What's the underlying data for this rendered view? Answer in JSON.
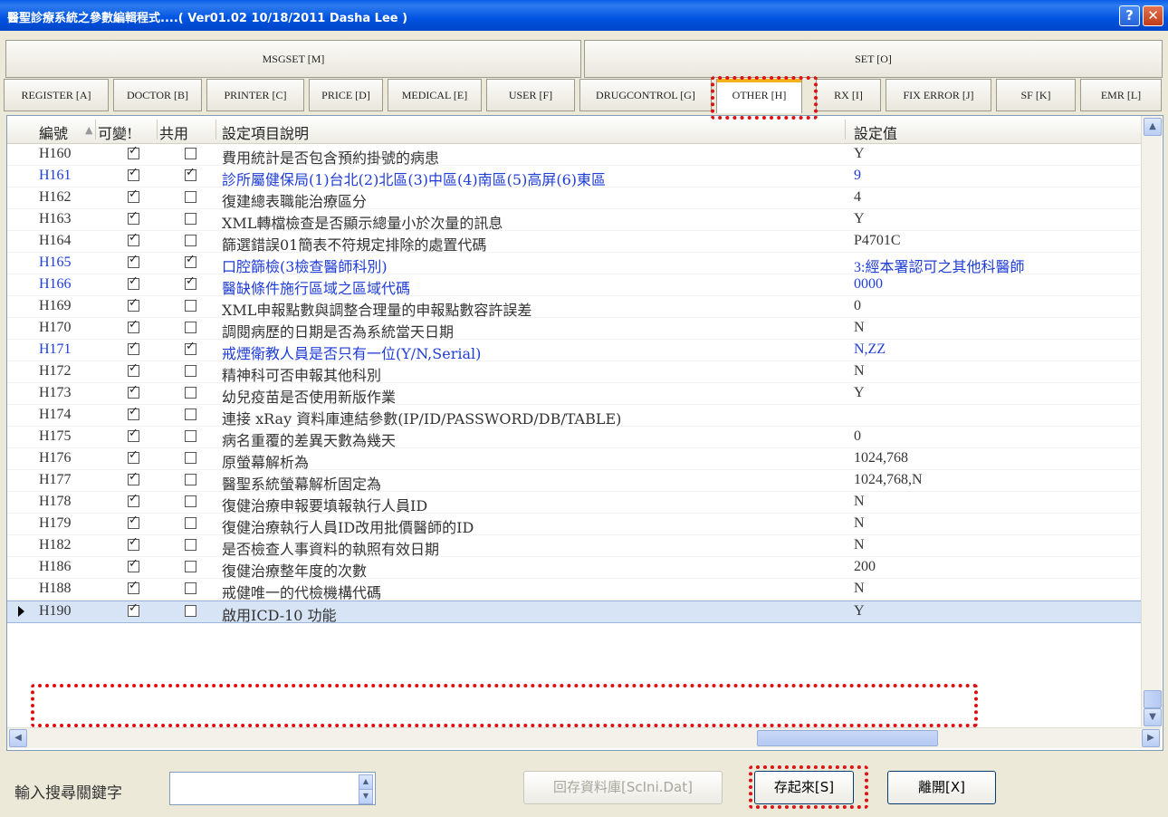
{
  "window": {
    "title": "醫聖診療系統之參數編輯程式....( Ver01.02 10/18/2011 Dasha Lee )",
    "help_label": "?",
    "close_label": "✕"
  },
  "groups": [
    {
      "label": "MSGSET [M]"
    },
    {
      "label": "SET [O]"
    }
  ],
  "tabs": [
    {
      "label": "REGISTER [A]"
    },
    {
      "label": "DOCTOR [B]"
    },
    {
      "label": "PRINTER [C]"
    },
    {
      "label": "PRICE [D]"
    },
    {
      "label": "MEDICAL [E]"
    },
    {
      "label": "USER [F]"
    },
    {
      "label": "DRUGCONTROL [G]"
    },
    {
      "label": "OTHER [H]"
    },
    {
      "label": "RX [I]"
    },
    {
      "label": "FIX ERROR [J]"
    },
    {
      "label": "SF [K]"
    },
    {
      "label": "EMR [L]"
    }
  ],
  "grid": {
    "headers": {
      "code": "編號",
      "changeable": "可變!",
      "shared": "共用",
      "desc": "設定項目說明",
      "value": "設定值"
    },
    "rows": [
      {
        "code": "H160",
        "changeable": true,
        "shared": false,
        "desc": "費用統計是否包含預約掛號的病患",
        "value": "Y",
        "blue": false
      },
      {
        "code": "H161",
        "changeable": true,
        "shared": true,
        "desc": "診所屬健保局(1)台北(2)北區(3)中區(4)南區(5)高屏(6)東區",
        "value": "9",
        "blue": true
      },
      {
        "code": "H162",
        "changeable": true,
        "shared": false,
        "desc": "復建總表職能治療區分",
        "value": "4",
        "blue": false
      },
      {
        "code": "H163",
        "changeable": true,
        "shared": false,
        "desc": "XML轉檔檢查是否顯示總量小於次量的訊息",
        "value": "Y",
        "blue": false
      },
      {
        "code": "H164",
        "changeable": true,
        "shared": false,
        "desc": "篩選錯誤01簡表不符規定排除的處置代碼",
        "value": "P4701C",
        "blue": false
      },
      {
        "code": "H165",
        "changeable": true,
        "shared": true,
        "desc": "口腔篩檢(3檢查醫師科別)",
        "value": "3:經本署認可之其他科醫師",
        "blue": true
      },
      {
        "code": "H166",
        "changeable": true,
        "shared": true,
        "desc": "醫缺條件施行區域之區域代碼",
        "value": "0000",
        "blue": true
      },
      {
        "code": "H169",
        "changeable": true,
        "shared": false,
        "desc": "XML申報點數與調整合理量的申報點數容許誤差",
        "value": "0",
        "blue": false
      },
      {
        "code": "H170",
        "changeable": true,
        "shared": false,
        "desc": "調閱病歷的日期是否為系統當天日期",
        "value": "N",
        "blue": false
      },
      {
        "code": "H171",
        "changeable": true,
        "shared": true,
        "desc": "戒煙衛教人員是否只有一位(Y/N,Serial)",
        "value": "N,ZZ",
        "blue": true
      },
      {
        "code": "H172",
        "changeable": true,
        "shared": false,
        "desc": "精神科可否申報其他科別",
        "value": "N",
        "blue": false
      },
      {
        "code": "H173",
        "changeable": true,
        "shared": false,
        "desc": "幼兒疫苗是否使用新版作業",
        "value": "Y",
        "blue": false
      },
      {
        "code": "H174",
        "changeable": true,
        "shared": false,
        "desc": "連接 xRay 資料庫連結參數(IP/ID/PASSWORD/DB/TABLE)",
        "value": "",
        "blue": false
      },
      {
        "code": "H175",
        "changeable": true,
        "shared": false,
        "desc": "病名重覆的差異天數為幾天",
        "value": "0",
        "blue": false
      },
      {
        "code": "H176",
        "changeable": true,
        "shared": false,
        "desc": "原螢幕解析為",
        "value": "1024,768",
        "blue": false
      },
      {
        "code": "H177",
        "changeable": true,
        "shared": false,
        "desc": "醫聖系統螢幕解析固定為",
        "value": "1024,768,N",
        "blue": false
      },
      {
        "code": "H178",
        "changeable": true,
        "shared": false,
        "desc": "復健治療申報要填報執行人員ID",
        "value": "N",
        "blue": false
      },
      {
        "code": "H179",
        "changeable": true,
        "shared": false,
        "desc": "復健治療執行人員ID改用批價醫師的ID",
        "value": "N",
        "blue": false
      },
      {
        "code": "H182",
        "changeable": true,
        "shared": false,
        "desc": "是否檢查人事資料的執照有效日期",
        "value": "N",
        "blue": false
      },
      {
        "code": "H186",
        "changeable": true,
        "shared": false,
        "desc": "復健治療整年度的次數",
        "value": "200",
        "blue": false
      },
      {
        "code": "H188",
        "changeable": true,
        "shared": false,
        "desc": "戒健唯一的代檢機構代碼",
        "value": "N",
        "blue": false
      },
      {
        "code": "H190",
        "changeable": true,
        "shared": false,
        "desc": "啟用ICD-10 功能",
        "value": "Y",
        "blue": false,
        "selected": true
      }
    ]
  },
  "bottom": {
    "search_label": "輸入搜尋關鍵字",
    "search_value": "",
    "restore_button": "回存資料庫[ScIni.Dat]",
    "save_button": "存起來[S]",
    "exit_button": "離開[X]"
  },
  "colors": {
    "highlight": "#E01010",
    "blue_text": "#1E3CD6",
    "titlebar": "#0053E0"
  }
}
